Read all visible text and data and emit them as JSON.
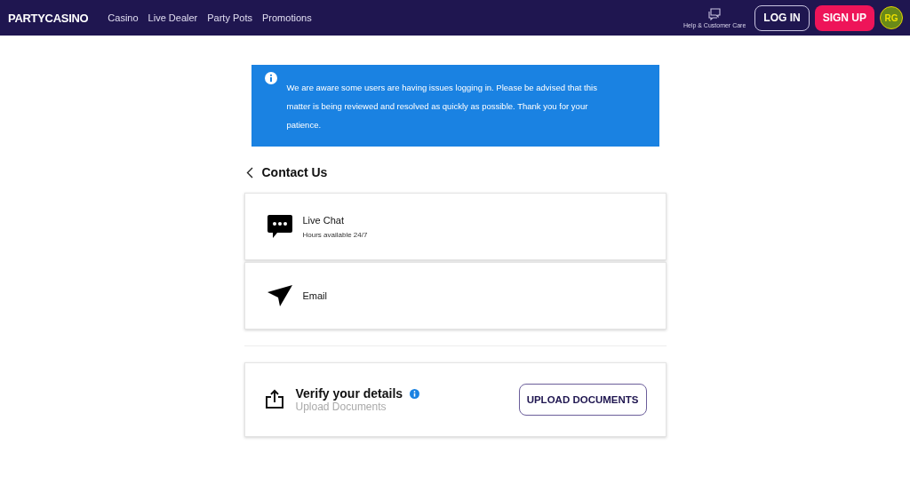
{
  "header": {
    "logo": "PARTYCASINO",
    "nav": [
      {
        "label": "Casino"
      },
      {
        "label": "Live Dealer"
      },
      {
        "label": "Party Pots"
      },
      {
        "label": "Promotions"
      }
    ],
    "help": "Help & Customer Care",
    "login": "LOG IN",
    "signup": "SIGN UP",
    "rg_badge": "RG"
  },
  "notice": {
    "text": "We are aware some users are having issues logging in. Please be advised that this matter is being reviewed and resolved as quickly as possible. Thank you for your patience."
  },
  "page_title": "Contact Us",
  "contact_options": [
    {
      "kind": "chat",
      "title": "Live Chat",
      "subtitle": "Hours available 24/7"
    },
    {
      "kind": "email",
      "title": "Email"
    }
  ],
  "verify": {
    "title": "Verify your details",
    "subtitle": "Upload Documents",
    "button": "UPLOAD DOCUMENTS"
  }
}
